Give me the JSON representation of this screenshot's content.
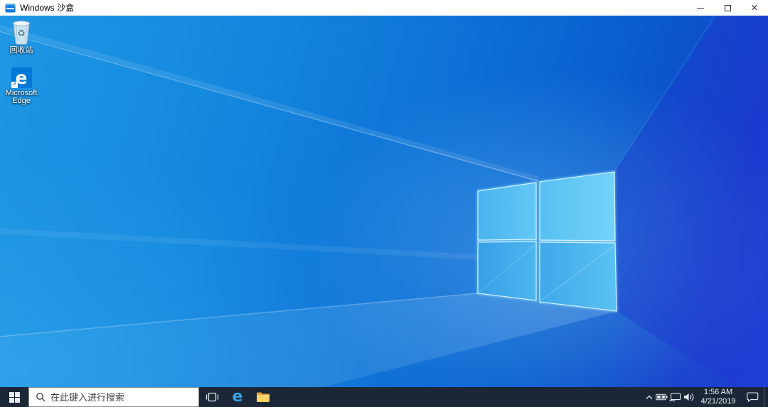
{
  "window": {
    "title": "Windows 沙盒"
  },
  "glyphs": {
    "close": "✕",
    "edge_letter": "e",
    "shortcut_arrow": "↗",
    "recycle_symbol": "♻"
  },
  "desktop": {
    "icons": [
      {
        "label": "回收站"
      },
      {
        "label": "Microsoft Edge"
      }
    ]
  },
  "taskbar": {
    "search": {
      "placeholder": "在此键入进行搜索"
    },
    "clock": {
      "time": "1:56 AM",
      "date": "4/21/2019"
    }
  },
  "colors": {
    "accent": "#0078d7",
    "titlebar_bg": "#ffffff",
    "taskbar_bg": "#1b2636",
    "search_bg": "#ffffff",
    "wallpaper_left": "#1e97e4",
    "wallpaper_right": "#2143d6",
    "logo_pane": "#4fb8f0",
    "logo_edge_glow": "#8fe9ff"
  }
}
